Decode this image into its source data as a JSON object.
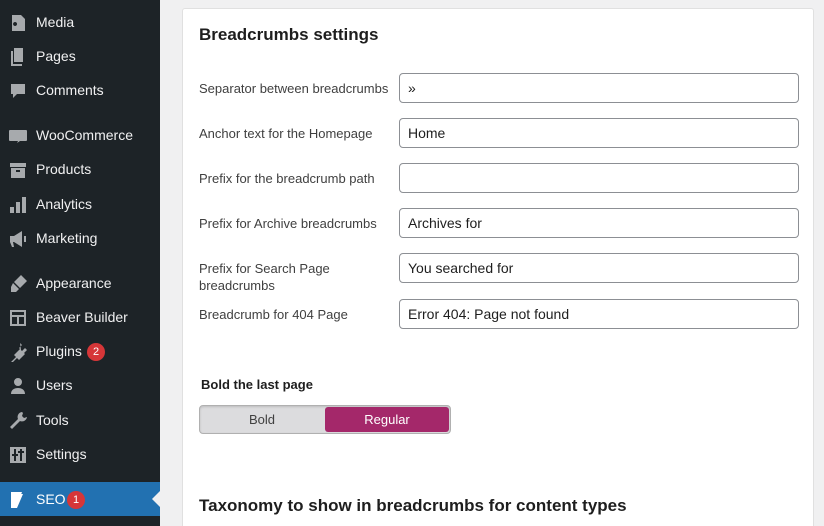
{
  "sidebar": {
    "items": [
      {
        "label": "Media",
        "icon": "media-icon"
      },
      {
        "label": "Pages",
        "icon": "pages-icon"
      },
      {
        "label": "Comments",
        "icon": "comments-icon"
      },
      {
        "label": "WooCommerce",
        "icon": "woocommerce-icon"
      },
      {
        "label": "Products",
        "icon": "products-icon"
      },
      {
        "label": "Analytics",
        "icon": "analytics-icon"
      },
      {
        "label": "Marketing",
        "icon": "marketing-icon"
      },
      {
        "label": "Appearance",
        "icon": "appearance-icon"
      },
      {
        "label": "Beaver Builder",
        "icon": "beaver-builder-icon"
      },
      {
        "label": "Plugins",
        "icon": "plugins-icon",
        "badge": "2"
      },
      {
        "label": "Users",
        "icon": "users-icon"
      },
      {
        "label": "Tools",
        "icon": "tools-icon"
      },
      {
        "label": "Settings",
        "icon": "settings-icon"
      },
      {
        "label": "SEO",
        "icon": "yoast-icon",
        "badge": "1",
        "active": true
      }
    ]
  },
  "panel": {
    "title": "Breadcrumbs settings",
    "fields": [
      {
        "label": "Separator between breadcrumbs",
        "value": "»"
      },
      {
        "label": "Anchor text for the Homepage",
        "value": "Home"
      },
      {
        "label": "Prefix for the breadcrumb path",
        "value": ""
      },
      {
        "label": "Prefix for Archive breadcrumbs",
        "value": "Archives for"
      },
      {
        "label": "Prefix for Search Page breadcrumbs",
        "value": "You searched for"
      },
      {
        "label": "Breadcrumb for 404 Page",
        "value": "Error 404: Page not found"
      }
    ],
    "bold_last_page": {
      "label": "Bold the last page",
      "options": [
        "Bold",
        "Regular"
      ],
      "selected": "Regular"
    },
    "taxonomy_title": "Taxonomy to show in breadcrumbs for content types"
  },
  "colors": {
    "sidebar_bg": "#1d2327",
    "active_bg": "#2271b1",
    "toggle_selected": "#a4286a",
    "badge": "#d63638"
  }
}
